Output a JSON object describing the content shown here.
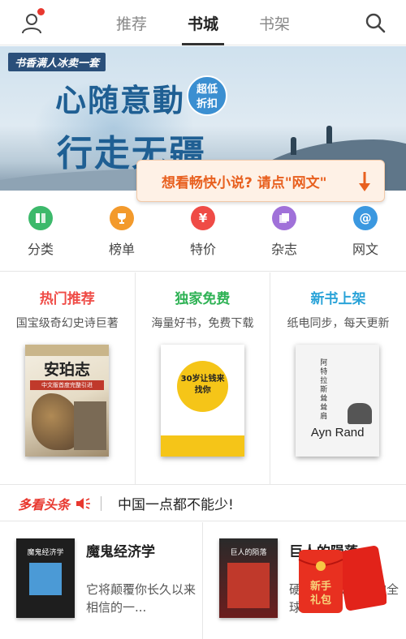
{
  "topbar": {
    "tabs": [
      {
        "label": "推荐",
        "active": false
      },
      {
        "label": "书城",
        "active": true
      },
      {
        "label": "书架",
        "active": false
      }
    ],
    "icons": {
      "user": "user-icon",
      "search": "search-icon"
    }
  },
  "banner": {
    "logo": "书香满人冰卖一套",
    "line1": "心随意動",
    "line2": "行走无疆",
    "badge_line1": "超低",
    "badge_line2": "折扣"
  },
  "tip": {
    "text": "想看畅快小说? 请点\"网文\""
  },
  "quick": [
    {
      "label": "分类",
      "icon": "book-icon",
      "color": "#3cb96b",
      "glyph": "▤"
    },
    {
      "label": "榜单",
      "icon": "trophy-icon",
      "color": "#f39a2c",
      "glyph": "🏆"
    },
    {
      "label": "特价",
      "icon": "yen-icon",
      "color": "#ef4b46",
      "glyph": "¥"
    },
    {
      "label": "杂志",
      "icon": "magazine-icon",
      "color": "#a071d9",
      "glyph": "▣"
    },
    {
      "label": "网文",
      "icon": "at-icon",
      "color": "#3b98e0",
      "glyph": "@"
    }
  ],
  "columns": [
    {
      "title": "热门推荐",
      "color": "#ef4b46",
      "subtitle": "国宝级奇幻史诗巨著",
      "book_title": "安珀志",
      "book_badge": "中文版首度完整引进"
    },
    {
      "title": "独家免费",
      "color": "#2fb255",
      "subtitle": "海量好书，免费下载",
      "book_title": "30岁让钱来找你"
    },
    {
      "title": "新书上架",
      "color": "#2aa3d8",
      "subtitle": "纸电同步，每天更新",
      "book_title": "阿特拉斯耸耸肩",
      "book_author": "Ayn Rand"
    }
  ],
  "headline": {
    "brand": "多看头条",
    "text": "中国一点都不能少!"
  },
  "bottom_books": [
    {
      "title": "魔鬼经济学",
      "desc": "它将颠覆你长久以来相信的一...",
      "cover_text": "魔鬼经济学"
    },
    {
      "title": "巨人的陨落",
      "desc": "硬核的历史巨榜的全球...",
      "cover_text": "巨人的陨落"
    }
  ],
  "redpacket": {
    "line1": "新手",
    "line2": "礼包"
  }
}
